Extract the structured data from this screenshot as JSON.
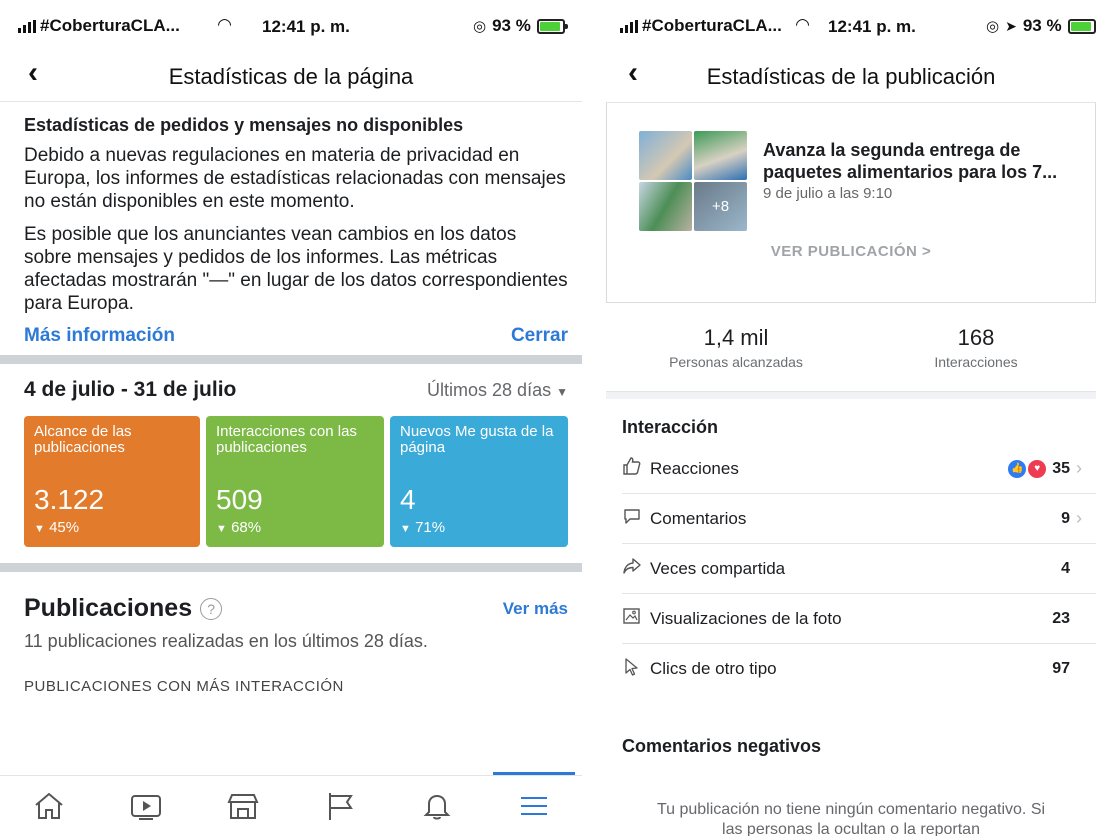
{
  "left": {
    "status": {
      "carrier": "#CoberturaCLA...",
      "time": "12:41 p. m.",
      "battery": "93 %"
    },
    "nav": {
      "title": "Estadísticas de la página"
    },
    "notice": {
      "title": "Estadísticas de pedidos y mensajes no disponibles",
      "p1": "Debido a nuevas regulaciones en materia de privacidad en Europa, los informes de estadísticas relacionadas con mensajes no están disponibles en este momento.",
      "p2": "Es posible que los anunciantes vean cambios en los datos sobre mensajes y pedidos de los informes. Las métricas afectadas mostrarán \"—\" en lugar de los datos correspondientes para Europa.",
      "more_link": "Más información",
      "close_link": "Cerrar"
    },
    "range": {
      "dates": "4 de julio - 31 de julio",
      "period": "Últimos 28 días"
    },
    "cards": [
      {
        "label": "Alcance de las publicaciones",
        "value": "3.122",
        "change": "45%",
        "color": "#e37b2c"
      },
      {
        "label": "Interacciones con las publicaciones",
        "value": "509",
        "change": "68%",
        "color": "#7cba45"
      },
      {
        "label": "Nuevos Me gusta de la página",
        "value": "4",
        "change": "71%",
        "color": "#3aaad8"
      }
    ],
    "pubs": {
      "title": "Publicaciones",
      "help": "?",
      "see_more": "Ver más",
      "subtitle": "11 publicaciones realizadas en los últimos 28 días.",
      "top_label": "PUBLICACIONES CON MÁS INTERACCIÓN"
    },
    "tabbar": [
      "home-icon",
      "video-icon",
      "marketplace-icon",
      "pages-flag-icon",
      "notifications-bell-icon",
      "menu-icon"
    ]
  },
  "right": {
    "status": {
      "carrier": "#CoberturaCLA...",
      "time": "12:41 p. m.",
      "battery": "93 %"
    },
    "nav": {
      "title": "Estadísticas de la publicación"
    },
    "post": {
      "title": "Avanza la segunda entrega de paquetes alimentarios para los 7...",
      "date": "9 de julio a las 9:10",
      "extra_photos": "+8",
      "view_link": "VER PUBLICACIÓN >"
    },
    "metrics": [
      {
        "value": "1,4 mil",
        "label": "Personas alcanzadas"
      },
      {
        "value": "168",
        "label": "Interacciones"
      }
    ],
    "interaction": {
      "title": "Interacción",
      "rows": [
        {
          "label": "Reacciones",
          "value": "35",
          "icon": "thumbs-up-icon",
          "chevron": true
        },
        {
          "label": "Comentarios",
          "value": "9",
          "icon": "comment-icon",
          "chevron": true
        },
        {
          "label": "Veces compartida",
          "value": "4",
          "icon": "share-icon",
          "chevron": false
        },
        {
          "label": "Visualizaciones de la foto",
          "value": "23",
          "icon": "photo-icon",
          "chevron": false
        },
        {
          "label": "Clics de otro tipo",
          "value": "97",
          "icon": "cursor-icon",
          "chevron": false
        }
      ]
    },
    "negative": {
      "title": "Comentarios negativos",
      "text": "Tu publicación no tiene ningún comentario negativo. Si las personas la ocultan o la reportan"
    }
  }
}
